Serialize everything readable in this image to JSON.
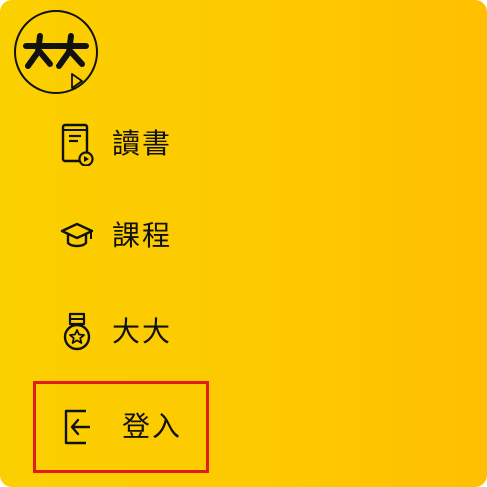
{
  "logo": {
    "text": "大大"
  },
  "menu": {
    "items": [
      {
        "label": "讀書",
        "icon": "book-play-icon"
      },
      {
        "label": "課程",
        "icon": "graduation-cap-icon"
      },
      {
        "label": "大大",
        "icon": "medal-star-icon"
      },
      {
        "label": "登入",
        "icon": "login-icon"
      }
    ]
  },
  "colors": {
    "background": "#fdc900",
    "text": "#111111",
    "highlight_border": "#e11c1c"
  }
}
